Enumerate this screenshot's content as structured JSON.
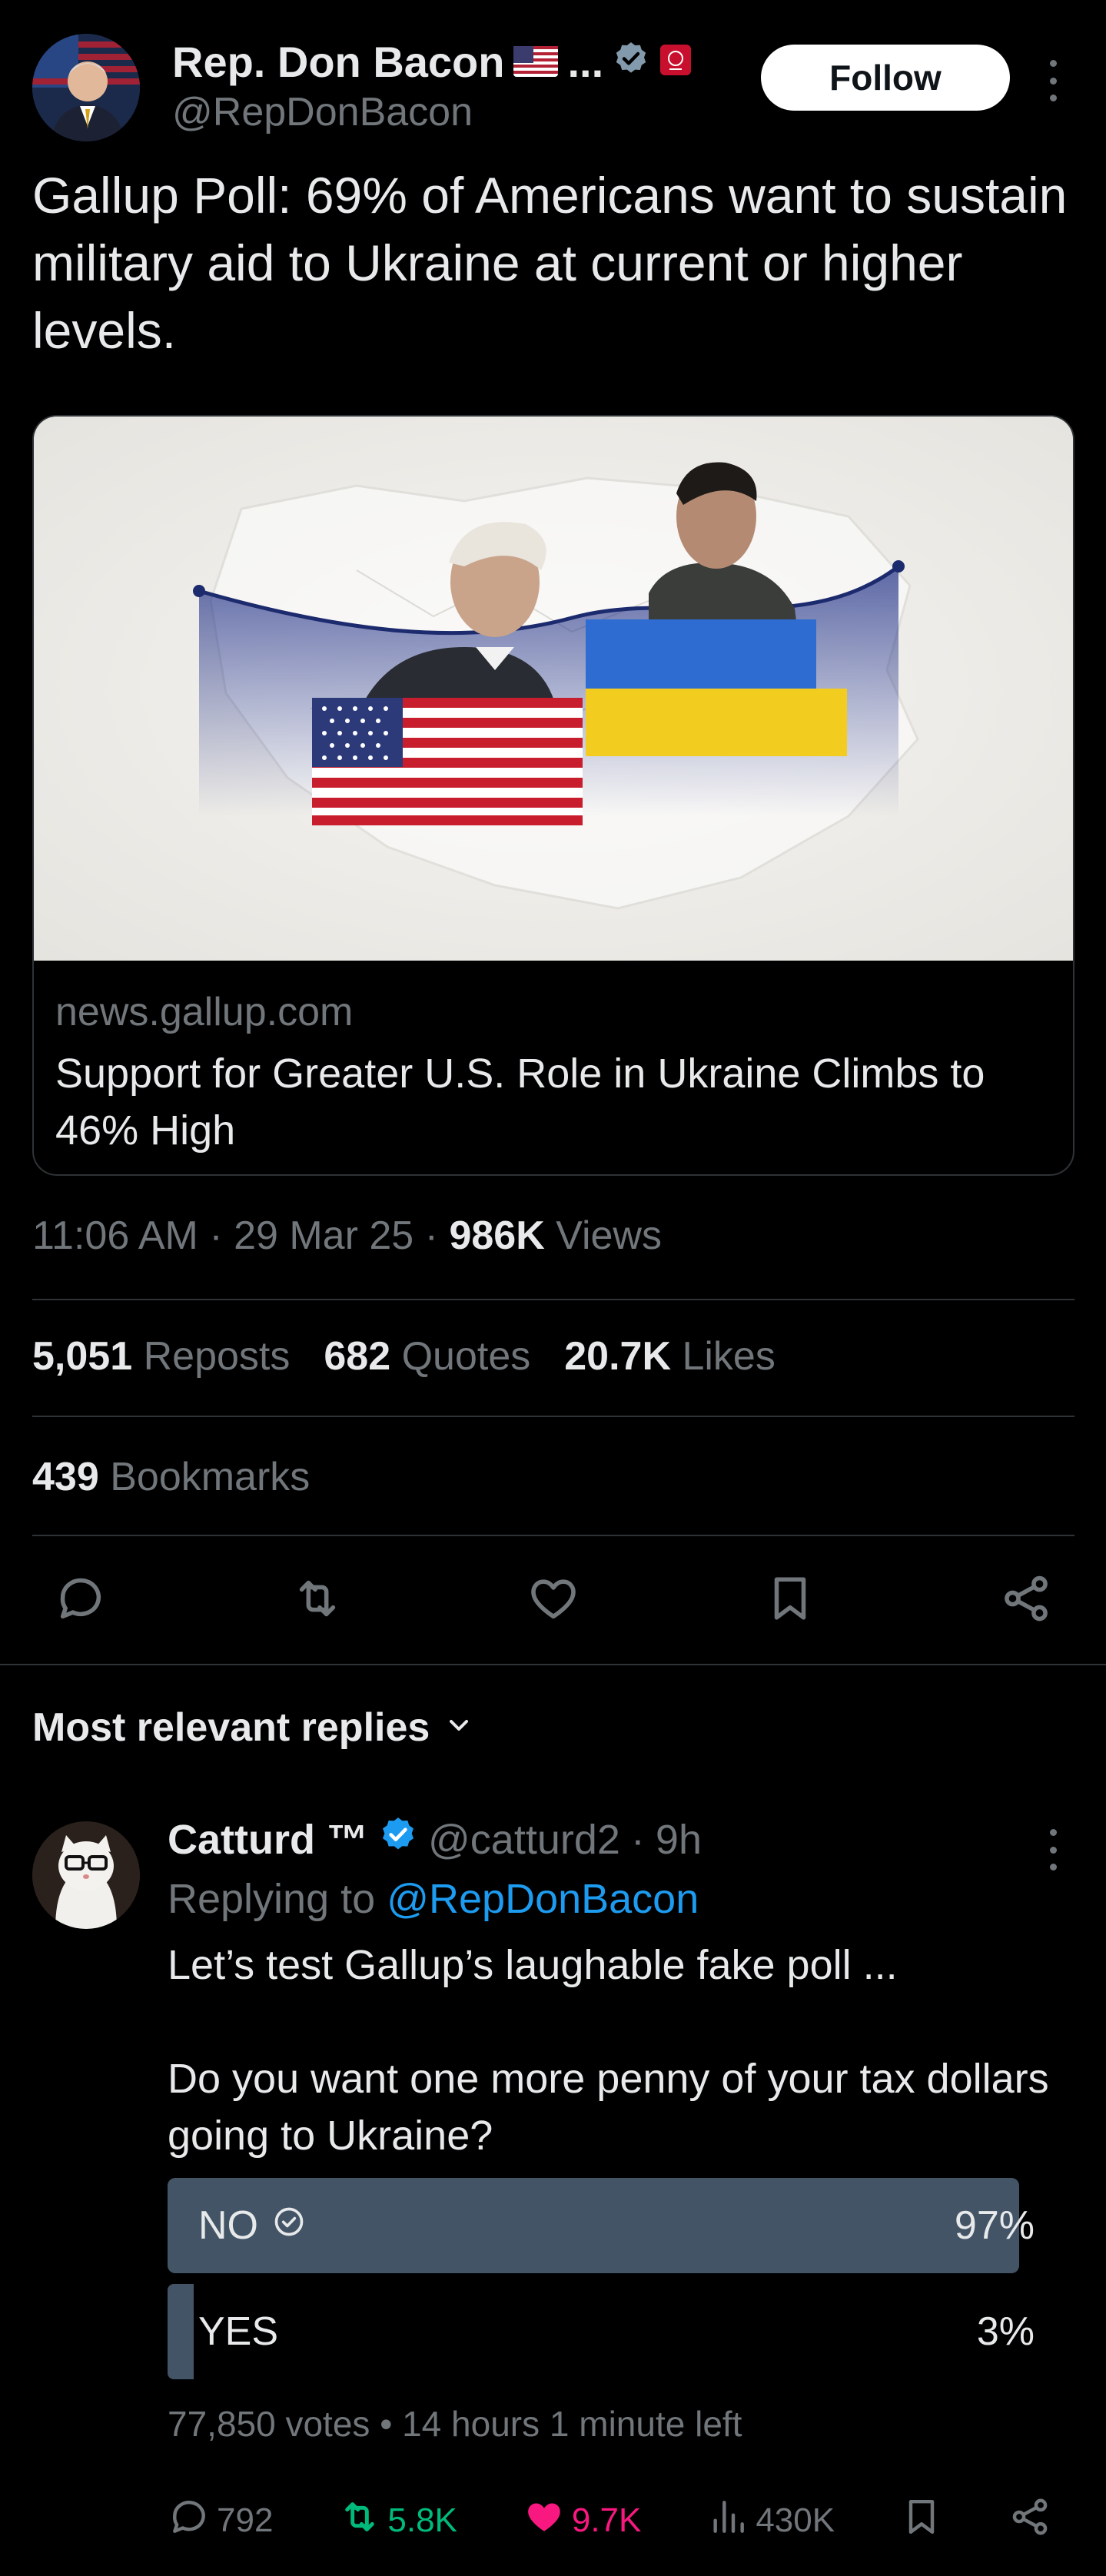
{
  "author": {
    "display_name": "Rep. Don Bacon",
    "name_suffix": "...",
    "handle": "@RepDonBacon",
    "follow_label": "Follow"
  },
  "tweet": {
    "text": "Gallup Poll: 69% of Americans want to sustain military aid to Ukraine at current or higher levels."
  },
  "card": {
    "domain": "news.gallup.com",
    "title": "Support for Greater U.S. Role in Ukraine Climbs to 46% High"
  },
  "meta": {
    "time": "11:06 AM",
    "date": "29 Mar 25",
    "views_count": "986K",
    "views_label": "Views"
  },
  "stats": {
    "reposts_count": "5,051",
    "reposts_label": "Reposts",
    "quotes_count": "682",
    "quotes_label": "Quotes",
    "likes_count": "20.7K",
    "likes_label": "Likes",
    "bookmarks_count": "439",
    "bookmarks_label": "Bookmarks"
  },
  "replies": {
    "sort_label": "Most relevant replies"
  },
  "reply": {
    "display_name": "Catturd ™",
    "handle": "@catturd2",
    "time": "9h",
    "replying_prefix": "Replying to",
    "replying_to": "@RepDonBacon",
    "text": "Let’s test Gallup’s laughable fake poll ...\n\nDo you want one more penny of your tax dollars going to Ukraine?",
    "poll": {
      "options": [
        {
          "label": "NO",
          "percent": "97%",
          "fraction": 0.97,
          "winner": true
        },
        {
          "label": "YES",
          "percent": "3%",
          "fraction": 0.03,
          "winner": false
        }
      ],
      "votes": "77,850 votes",
      "time_left": "14 hours 1 minute left"
    },
    "actions": {
      "replies": "792",
      "reposts": "5.8K",
      "likes": "9.7K",
      "views": "430K"
    }
  },
  "colors": {
    "accent": "#1d9bf0",
    "muted": "#71767b",
    "divider": "#2f3336",
    "poll_fill": "#425466",
    "repost_active": "#00ba7c",
    "like_active": "#f91880"
  }
}
